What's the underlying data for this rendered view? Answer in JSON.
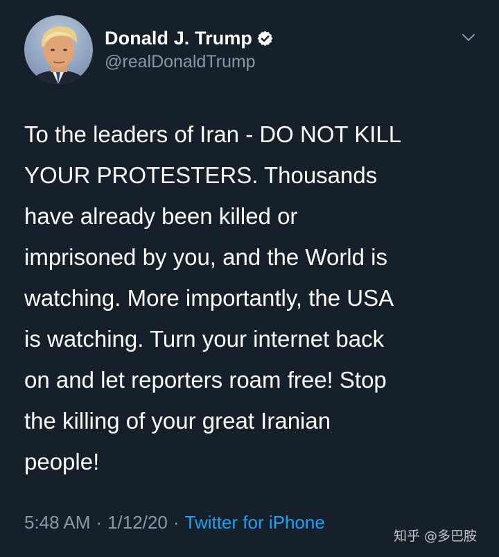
{
  "author": {
    "display_name": "Donald J. Trump",
    "handle": "@realDonaldTrump",
    "verified": true,
    "avatar_icon": "profile-photo"
  },
  "tweet": {
    "text": "To the leaders of Iran - DO NOT KILL\nYOUR PROTESTERS. Thousands\nhave already been killed or\nimprisoned by you, and the World is\nwatching. More importantly, the USA\nis watching. Turn your internet back\non and let reporters roam free! Stop\nthe killing of your great Iranian\npeople!"
  },
  "meta": {
    "time": "5:48 AM",
    "date": "1/12/20",
    "separator": "·",
    "source": "Twitter for iPhone"
  },
  "watermark": "知乎 @多巴胺",
  "colors": {
    "background": "#15202b",
    "text": "#ffffff",
    "secondary": "#8899a6",
    "link": "#1da1f2"
  }
}
